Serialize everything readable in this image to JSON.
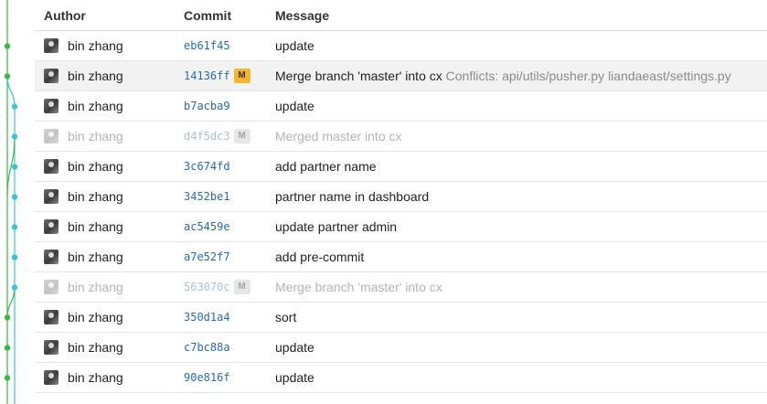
{
  "header": {
    "author": "Author",
    "commit": "Commit",
    "message": "Message"
  },
  "commits": [
    {
      "author": "bin zhang",
      "hash": "eb61f45",
      "badge": "",
      "message": "update",
      "conflicts": "",
      "dim": false,
      "selected": false
    },
    {
      "author": "bin zhang",
      "hash": "14136ff",
      "badge": "M",
      "message": "Merge branch 'master' into cx",
      "conflicts": "Conflicts: api/utils/pusher.py liandaeast/settings.py",
      "dim": false,
      "selected": true
    },
    {
      "author": "bin zhang",
      "hash": "b7acba9",
      "badge": "",
      "message": "update",
      "conflicts": "",
      "dim": false,
      "selected": false
    },
    {
      "author": "bin zhang",
      "hash": "d4f5dc3",
      "badge": "M",
      "message": "Merged master into cx",
      "conflicts": "",
      "dim": true,
      "selected": false
    },
    {
      "author": "bin zhang",
      "hash": "3c674fd",
      "badge": "",
      "message": "add partner name",
      "conflicts": "",
      "dim": false,
      "selected": false
    },
    {
      "author": "bin zhang",
      "hash": "3452be1",
      "badge": "",
      "message": "partner name in dashboard",
      "conflicts": "",
      "dim": false,
      "selected": false
    },
    {
      "author": "bin zhang",
      "hash": "ac5459e",
      "badge": "",
      "message": "update partner admin",
      "conflicts": "",
      "dim": false,
      "selected": false
    },
    {
      "author": "bin zhang",
      "hash": "a7e52f7",
      "badge": "",
      "message": "add pre-commit",
      "conflicts": "",
      "dim": false,
      "selected": false
    },
    {
      "author": "bin zhang",
      "hash": "563070c",
      "badge": "M",
      "message": "Merge branch 'master' into cx",
      "conflicts": "",
      "dim": true,
      "selected": false
    },
    {
      "author": "bin zhang",
      "hash": "350d1a4",
      "badge": "",
      "message": "sort",
      "conflicts": "",
      "dim": false,
      "selected": false
    },
    {
      "author": "bin zhang",
      "hash": "c7bc88a",
      "badge": "",
      "message": "update",
      "conflicts": "",
      "dim": false,
      "selected": false
    },
    {
      "author": "bin zhang",
      "hash": "90e816f",
      "badge": "",
      "message": "update",
      "conflicts": "",
      "dim": false,
      "selected": false
    }
  ],
  "graph": {
    "colors": {
      "master": "#3cb54a",
      "cx": "#3bc4d6"
    },
    "lanes": [
      "master",
      "master",
      "cx",
      "cx",
      "cx",
      "cx",
      "cx",
      "cx",
      "cx",
      "master",
      "master",
      "master"
    ]
  }
}
